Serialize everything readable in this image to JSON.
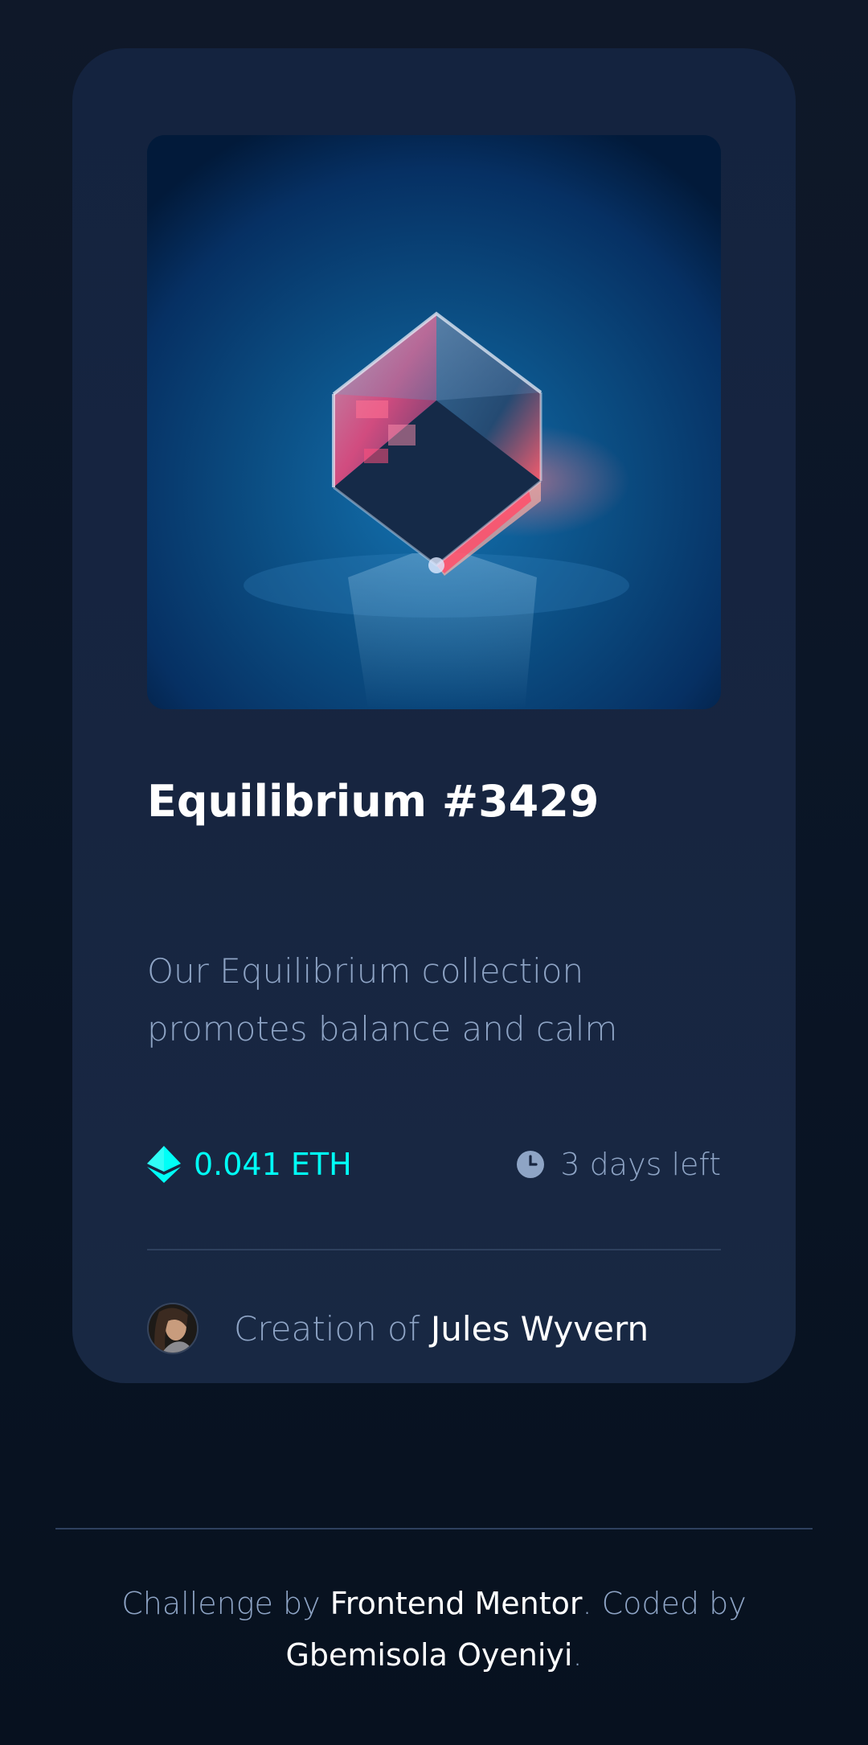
{
  "card": {
    "title": "Equilibrium #3429",
    "description": "Our Equilibrium collection promotes balance and calm",
    "price": "0.041 ETH",
    "time_left": "3 days left",
    "creator_prefix": "Creation of ",
    "creator_name": "Jules Wyvern",
    "icons": {
      "price": "ethereum-icon",
      "time": "clock-icon"
    },
    "colors": {
      "price": "#00fff7",
      "muted": "#8ea4c5",
      "card_bg": "#15263f"
    }
  },
  "footer": {
    "challenge_prefix": "Challenge by ",
    "challenge_link": "Frontend Mentor",
    "coded_prefix": ". Coded by ",
    "coded_link": "Gbemisola Oyeniyi",
    "suffix": "."
  }
}
